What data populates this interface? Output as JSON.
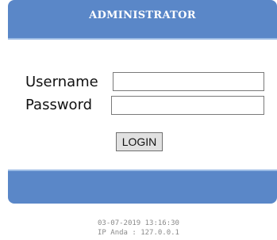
{
  "login_panel": {
    "title": "ADMINISTRATOR",
    "username_label": "Username",
    "username_value": "",
    "password_label": "Password",
    "password_value": "",
    "login_button": "LOGIN"
  },
  "footer_info": {
    "timestamp": "03-07-2019 13:16:30",
    "ip_text": "IP Anda : 127.0.0.1"
  },
  "colors": {
    "header_blue": "#5a87c8",
    "header_border": "#9bbbe4"
  }
}
